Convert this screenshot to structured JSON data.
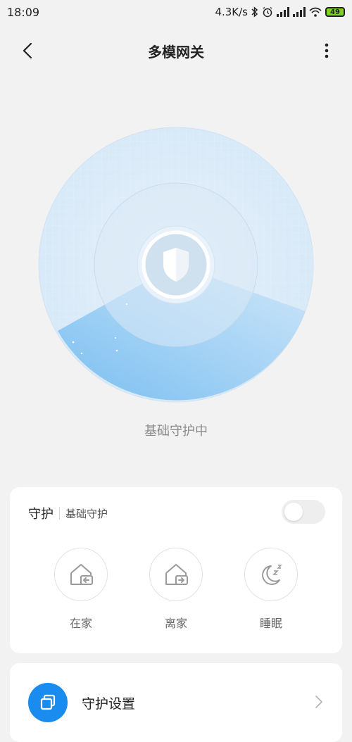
{
  "status_bar": {
    "time": "18:09",
    "net_speed": "4.3K/s",
    "battery": "49",
    "icons": [
      "bluetooth-icon",
      "alarm-icon",
      "signal-icon",
      "signal-icon",
      "wifi-icon",
      "battery-icon"
    ]
  },
  "header": {
    "title": "多模网关",
    "back_icon": "back-arrow-icon",
    "more_icon": "more-vertical-icon"
  },
  "radar": {
    "center_icon": "shield-icon",
    "status_text": "基础守护中",
    "colors": {
      "outer": "#dcebf8",
      "sweep": "#8ccbf5",
      "accent": "#1a8cf0"
    }
  },
  "guard_card": {
    "title": "守护",
    "subtitle": "基础守护",
    "toggle_on": false,
    "modes": [
      {
        "label": "在家",
        "icon": "home-enter-icon"
      },
      {
        "label": "离家",
        "icon": "home-leave-icon"
      },
      {
        "label": "睡眠",
        "icon": "moon-sleep-icon"
      }
    ]
  },
  "settings": {
    "label": "守护设置",
    "icon": "layers-icon"
  }
}
